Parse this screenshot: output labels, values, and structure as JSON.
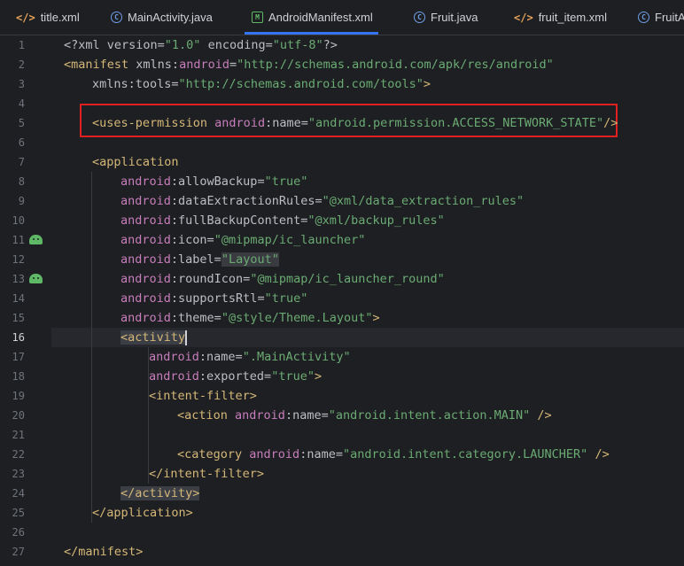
{
  "tabs": [
    {
      "label": "title.xml",
      "icon": "xml-file-icon"
    },
    {
      "label": "MainActivity.java",
      "icon": "java-class-icon"
    },
    {
      "label": "AndroidManifest.xml",
      "icon": "android-manifest-icon",
      "active": true
    },
    {
      "label": "Fruit.java",
      "icon": "java-class-icon"
    },
    {
      "label": "fruit_item.xml",
      "icon": "xml-file-icon"
    },
    {
      "label": "FruitA",
      "icon": "java-class-icon"
    }
  ],
  "line_numbers": [
    "1",
    "2",
    "3",
    "4",
    "5",
    "6",
    "7",
    "8",
    "9",
    "10",
    "11",
    "12",
    "13",
    "14",
    "15",
    "16",
    "17",
    "18",
    "19",
    "20",
    "21",
    "22",
    "23",
    "24",
    "25",
    "26",
    "27"
  ],
  "current_line": "16",
  "code": {
    "l1": {
      "p1": "<?xml version=",
      "v1": "\"1.0\"",
      "p2": " encoding=",
      "v2": "\"utf-8\"",
      "p3": "?>"
    },
    "l2": {
      "t": "<manifest",
      "sp": " ",
      "ns": "xmlns:",
      "a": "android",
      "eq": "=",
      "v": "\"http://schemas.android.com/apk/res/android\""
    },
    "l3": {
      "a": "xmlns:tools=",
      "v": "\"http://schemas.android.com/tools\"",
      "t": ">"
    },
    "l5": {
      "t": "<uses-permission",
      "ns": " android",
      "a": ":name=",
      "v": "\"android.permission.ACCESS_NETWORK_STATE\"",
      "e": "/>"
    },
    "l7": {
      "t": "<application"
    },
    "l8": {
      "ns": "android",
      "a": ":allowBackup=",
      "v": "\"true\""
    },
    "l9": {
      "ns": "android",
      "a": ":dataExtractionRules=",
      "v": "\"@xml/data_extraction_rules\""
    },
    "l10": {
      "ns": "android",
      "a": ":fullBackupContent=",
      "v": "\"@xml/backup_rules\""
    },
    "l11": {
      "ns": "android",
      "a": ":icon=",
      "v": "\"@mipmap/ic_launcher\""
    },
    "l12": {
      "ns": "android",
      "a": ":label=",
      "v": "\"Layout\""
    },
    "l13": {
      "ns": "android",
      "a": ":roundIcon=",
      "v": "\"@mipmap/ic_launcher_round\""
    },
    "l14": {
      "ns": "android",
      "a": ":supportsRtl=",
      "v": "\"true\""
    },
    "l15": {
      "ns": "android",
      "a": ":theme=",
      "v": "\"@style/Theme.Layout\"",
      "t": ">"
    },
    "l16": {
      "t": "<activity"
    },
    "l17": {
      "ns": "android",
      "a": ":name=",
      "v": "\".MainActivity\""
    },
    "l18": {
      "ns": "android",
      "a": ":exported=",
      "v": "\"true\"",
      "t": ">"
    },
    "l19": {
      "t": "<intent-filter>"
    },
    "l20": {
      "t": "<action",
      "ns": " android",
      "a": ":name=",
      "v": "\"android.intent.action.MAIN\"",
      "e": " />"
    },
    "l22": {
      "t": "<category",
      "ns": " android",
      "a": ":name=",
      "v": "\"android.intent.category.LAUNCHER\"",
      "e": " />"
    },
    "l23": {
      "t": "</intent-filter>"
    },
    "l24": {
      "t": "</activity>"
    },
    "l25": {
      "t": "</application>"
    },
    "l27": {
      "t": "</manifest>"
    }
  },
  "colors": {
    "tag": "#d5b778",
    "namespace": "#c77dbb",
    "string": "#6aab73",
    "active_tab_underline": "#3574f0",
    "highlight_box": "#e02020"
  }
}
